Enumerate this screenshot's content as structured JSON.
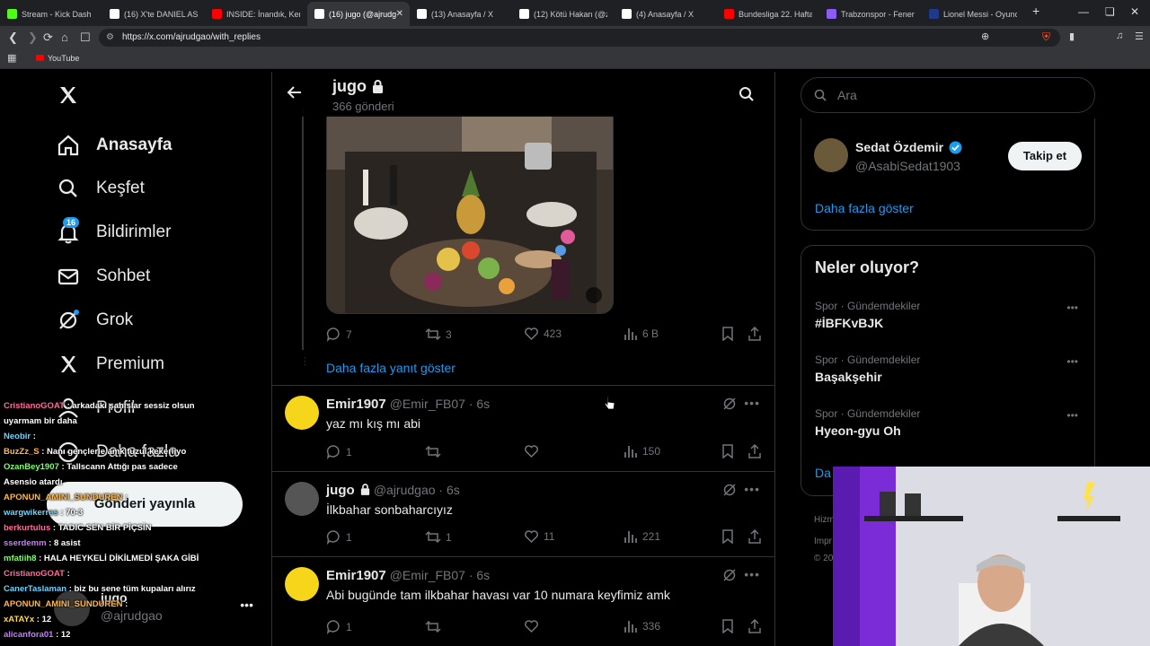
{
  "browser": {
    "tabs": [
      {
        "label": "Stream - Kick Dash",
        "color": "#53fc18"
      },
      {
        "label": "(16) X'te DANIEL ASAN",
        "color": "#ffffff"
      },
      {
        "label": "INSIDE: İnandık, Kenet",
        "color": "#ff0000"
      },
      {
        "label": "(16) jugo (@ajrudg",
        "color": "#ffffff",
        "active": true
      },
      {
        "label": "(13) Anasayfa / X",
        "color": "#ffffff"
      },
      {
        "label": "(12) Kötü Hakan (@zin",
        "color": "#ffffff"
      },
      {
        "label": "(4) Anasayfa / X",
        "color": "#ffffff"
      },
      {
        "label": "Bundesliga 22. Hafta Ö",
        "color": "#ff0000"
      },
      {
        "label": "Trabzonspor - Fenerba",
        "color": "#8b5cf6"
      },
      {
        "label": "Lionel Messi - Oyuncu",
        "color": "#1e3a8a"
      }
    ],
    "new_tab": "+",
    "url": "https://x.com/ajrudgao/with_replies",
    "bookmark": "YouTube"
  },
  "nav": {
    "items": [
      {
        "label": "Anasayfa"
      },
      {
        "label": "Keşfet"
      },
      {
        "label": "Bildirimler"
      },
      {
        "label": "Sohbet"
      },
      {
        "label": "Grok"
      },
      {
        "label": "Premium"
      },
      {
        "label": "Profil"
      },
      {
        "label": "Daha fazla"
      }
    ],
    "notif_count": "16",
    "post_button": "Gönderi yayınla",
    "account_name": "jugo",
    "account_handle": "@ajrudgao"
  },
  "header": {
    "name": "jugo",
    "posts": "366 gönderi"
  },
  "tweets": [
    {
      "id": "media",
      "replies": "7",
      "retweets": "3",
      "likes": "423",
      "views": "6 B"
    },
    {
      "id": "show_more",
      "label": "Daha fazla yanıt göster"
    },
    {
      "id": "t1",
      "name": "Emir1907",
      "handle": "@Emir_FB07 · 6s",
      "text": "yaz mı kış mı abi",
      "replies": "1",
      "retweets": "",
      "likes": "",
      "views": "150",
      "avatar_color": "#f6d61a"
    },
    {
      "id": "t2",
      "name": "jugo",
      "handle": "@ajrudgao · 6s",
      "text": "İlkbahar sonbaharcıyız",
      "replies": "1",
      "retweets": "1",
      "likes": "11",
      "views": "221",
      "avatar_color": "#555"
    },
    {
      "id": "t3",
      "name": "Emir1907",
      "handle": "@Emir_FB07 · 6s",
      "text": "Abi bugünde tam ilkbahar havası var 10 numara keyfimiz amk",
      "replies": "1",
      "retweets": "",
      "likes": "",
      "views": "336",
      "avatar_color": "#f6d61a"
    }
  ],
  "right": {
    "search_placeholder": "Ara",
    "suggest": {
      "name": "Sedat Özdemir",
      "handle": "@AsabiSedat1903",
      "follow": "Takip et",
      "show_more": "Daha fazla göster"
    },
    "trends_title": "Neler oluyor?",
    "trends": [
      {
        "context": "Spor · Gündemdekiler",
        "name": "#İBFKvBJK"
      },
      {
        "context": "Spor · Gündemdekiler",
        "name": "Başakşehir"
      },
      {
        "context": "Spor · Gündemdekiler",
        "name": "Hyeon-gyu Oh"
      }
    ],
    "trends_more": "Da",
    "footer_1": "Hizm",
    "footer_2": "Impr",
    "footer_3": "© 20"
  },
  "chat": [
    {
      "user": "CristianoGOAT",
      "color": "#ff6b9a",
      "msg": ": arkadaki şahıslar sessiz olsun"
    },
    {
      "user": "",
      "color": "#ffffff",
      "msg": "uyarmam bir daha"
    },
    {
      "user": "Neobir",
      "color": "#6bd3ff",
      "msg": ":"
    },
    {
      "user": "BuzZz_S",
      "color": "#ffb84d",
      "msg": ": Nanı gençlerle amk fuzul kekerliyo"
    },
    {
      "user": "OzanBey1907",
      "color": "#7cff6b",
      "msg": ": Tallscann Attığı pas sadece"
    },
    {
      "user": "",
      "color": "#ffffff",
      "msg": "Asensio atardı"
    },
    {
      "user": "APONUN_AMINI_SUNDUREN",
      "color": "#ffb84d",
      "msg": ":"
    },
    {
      "user": "wargwikerres",
      "color": "#6bd3ff",
      "msg": ": 70-3"
    },
    {
      "user": "berkurtulus",
      "color": "#ff6b9a",
      "msg": ": TADIC SEN BİR PİÇSİN"
    },
    {
      "user": "sserdemm",
      "color": "#c77dff",
      "msg": ": 8 asist"
    },
    {
      "user": "mfatiih8",
      "color": "#7cff6b",
      "msg": ": HALA HEYKELİ DİKİLMEDİ ŞAKA GİBİ"
    },
    {
      "user": "CristianoGOAT",
      "color": "#ff6b9a",
      "msg": ":"
    },
    {
      "user": "CanerTaslaman",
      "color": "#6bd3ff",
      "msg": ": biz bu sene tüm kupaları alırız"
    },
    {
      "user": "APONUN_AMINI_SUNDUREN",
      "color": "#ffb84d",
      "msg": ":"
    },
    {
      "user": "xATAYx",
      "color": "#ffd84d",
      "msg": ": 12"
    },
    {
      "user": "alicanfora01",
      "color": "#c77dff",
      "msg": ": 12"
    }
  ],
  "icons": {
    "x_logo": "x-logo-icon",
    "back": "back-arrow-icon",
    "search": "search-icon",
    "lock": "lock-icon",
    "verified": "verified-badge-icon"
  },
  "colors": {
    "accent": "#1d9bf0",
    "text": "#e7e9ea",
    "muted": "#71767b",
    "border": "#2f3336"
  }
}
